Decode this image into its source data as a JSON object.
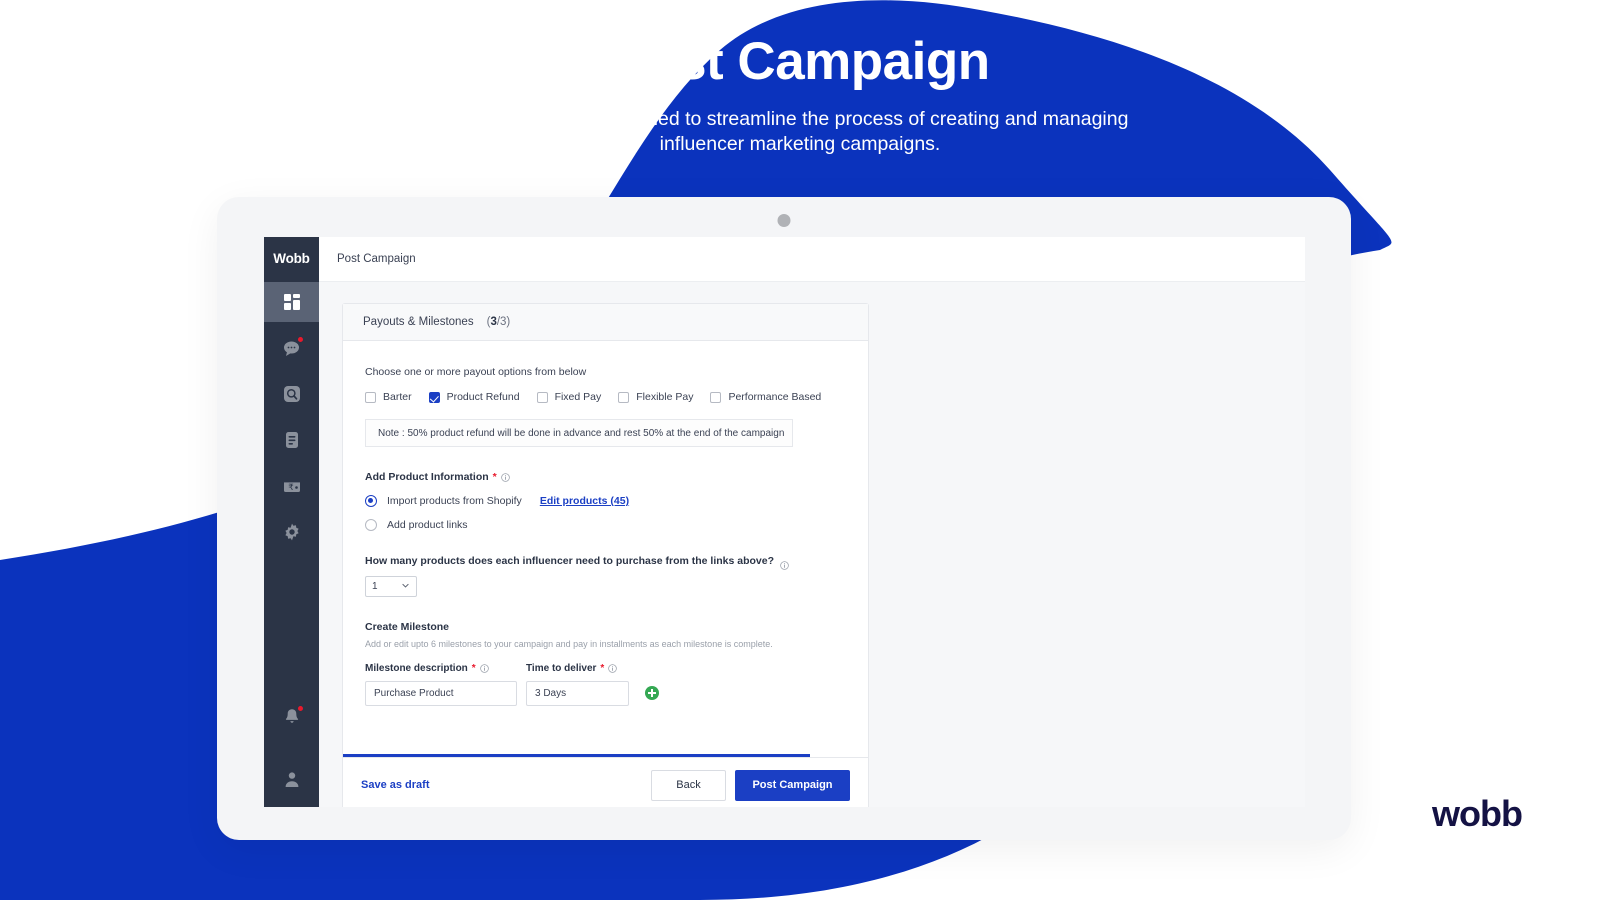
{
  "hero": {
    "title": "Post Campaign",
    "subtitle": "This section is designed to streamline the process of creating and managing influencer marketing campaigns."
  },
  "brand": {
    "accent_blue": "#1b3fc4",
    "bg_blue": "#0b33bd",
    "sidebar_dark": "#2b3446",
    "green": "#34a853",
    "red_badge": "#e8192c",
    "logo_navy": "#141244",
    "footer_logo": "wobb"
  },
  "sidebar": {
    "logo": "Wobb",
    "items": [
      {
        "name": "dashboard-icon",
        "active": true
      },
      {
        "name": "chat-icon",
        "active": false,
        "badge": true
      },
      {
        "name": "search-icon",
        "active": false
      },
      {
        "name": "document-icon",
        "active": false
      },
      {
        "name": "payments-icon",
        "active": false
      },
      {
        "name": "settings-gear-icon",
        "active": false
      }
    ],
    "bottom_items": [
      {
        "name": "notifications-bell-icon",
        "badge": true
      },
      {
        "name": "user-avatar-icon",
        "badge": false
      }
    ]
  },
  "topbar": {
    "title": "Post Campaign"
  },
  "card": {
    "header_title": "Payouts & Milestones",
    "step_current": "3",
    "step_total": "/3)",
    "step_open": "(",
    "payout": {
      "prompt": "Choose one or more payout options from below",
      "options": [
        {
          "label": "Barter",
          "checked": false
        },
        {
          "label": "Product Refund",
          "checked": true
        },
        {
          "label": "Fixed Pay",
          "checked": false
        },
        {
          "label": "Flexible Pay",
          "checked": false
        },
        {
          "label": "Performance Based",
          "checked": false
        }
      ],
      "note": "Note : 50% product refund will be done in advance and rest 50% at the end of the campaign"
    },
    "product_info": {
      "label": "Add Product Information",
      "required_mark": "*",
      "radios": [
        {
          "label": "Import products from Shopify",
          "selected": true
        },
        {
          "label": "Add product links",
          "selected": false
        }
      ],
      "edit_link": "Edit products (45)"
    },
    "quantity": {
      "question": "How many products does each influencer need to purchase from the links above?",
      "value": "1"
    },
    "milestone": {
      "title": "Create Milestone",
      "subtitle": "Add or edit upto 6 milestones to your campaign and pay in installments as each milestone is complete.",
      "description_label": "Milestone description",
      "description_required": "*",
      "description_value": "Purchase Product",
      "time_label": "Time to deliver",
      "time_required": "*",
      "time_value": "3 Days",
      "add_button": "add-milestone-button"
    },
    "progress_percent": 89,
    "footer": {
      "save_draft": "Save as draft",
      "back": "Back",
      "post": "Post Campaign"
    }
  }
}
